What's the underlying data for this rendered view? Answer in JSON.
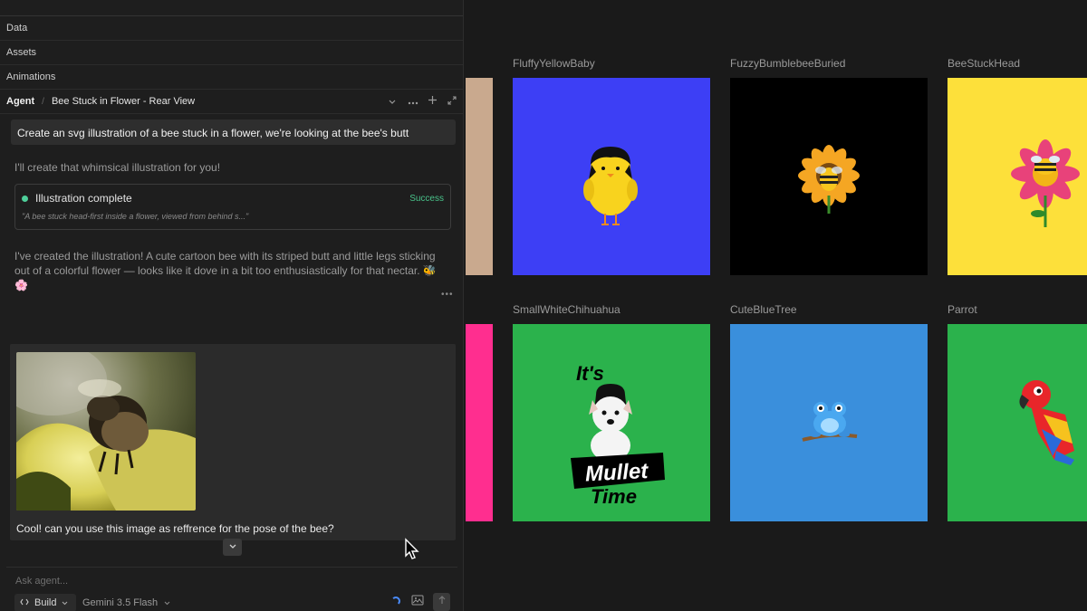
{
  "sidebar": {
    "sections": [
      {
        "label": "Data"
      },
      {
        "label": "Assets"
      },
      {
        "label": "Animations"
      }
    ]
  },
  "agent": {
    "label": "Agent",
    "conversation_title": "Bee Stuck in Flower - Rear View",
    "tools": [
      "chevron-down-icon",
      "more-icon",
      "plus-icon",
      "expand-icon"
    ]
  },
  "chat": {
    "user_message_1": "Create an svg illustration of a bee stuck in a flower, we're looking at the bee's butt",
    "assistant_message_1": "I'll create that whimsical illustration for you!",
    "tool_call": {
      "title": "Illustration complete",
      "status": "Success",
      "status_color": "#49c28a",
      "quote": "\"A bee stuck head-first inside a flower, viewed from behind s...\""
    },
    "assistant_message_2": "I've created the illustration! A cute cartoon bee with its striped butt and little legs sticking out of a colorful flower — looks like it dove in a bit too enthusiastically for that nectar. 🐝🌸",
    "more_label": "•••",
    "user_message_2": "Cool! can you use this image as reffrence for the pose of the bee?"
  },
  "composer": {
    "placeholder": "Ask agent...",
    "mode": "Build",
    "model": "Gemini 3.5 Flash"
  },
  "gallery": {
    "row1": [
      {
        "name": "FluffyYellowBaby",
        "bg": "#3d3ff5"
      },
      {
        "name": "FuzzyBumblebeeBuried",
        "bg": "#000000"
      },
      {
        "name": "BeeStuckHead",
        "bg": "#fde03a"
      }
    ],
    "row2": [
      {
        "name": "SmallWhiteChihuahua",
        "bg": "#2bb24c",
        "text_1": "It's",
        "text_2": "Mullet",
        "text_3": "Time"
      },
      {
        "name": "CuteBlueTree",
        "bg": "#3a8fdc"
      },
      {
        "name": "Parrot",
        "bg": "#2bb24c"
      }
    ],
    "partial_colors": [
      "#c9a98e",
      "#ff2e8f"
    ]
  }
}
